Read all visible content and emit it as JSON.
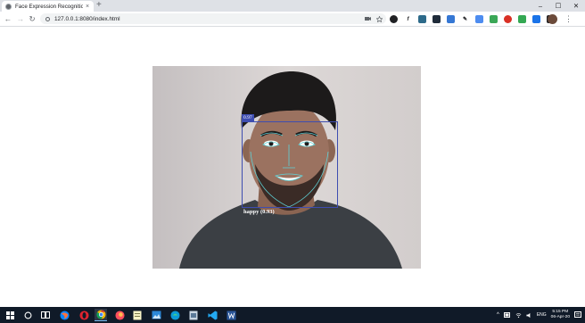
{
  "browser": {
    "tab_title": "Face Expression Recognition",
    "tab_close": "×",
    "new_tab": "+",
    "url": "127.0.0.1:8080/index.html",
    "window_controls": {
      "minimize": "–",
      "maximize": "☐",
      "close": "✕"
    },
    "nav": {
      "back": "←",
      "forward": "→",
      "reload": "↻"
    },
    "menu": "⋮"
  },
  "detection": {
    "score_label": "0.97",
    "expression_label": "happy (0.93)",
    "box_color": "#3e4db0"
  },
  "taskbar": {
    "language": "ENG",
    "time": "5:15 PM",
    "date": "06-Apr-20"
  }
}
